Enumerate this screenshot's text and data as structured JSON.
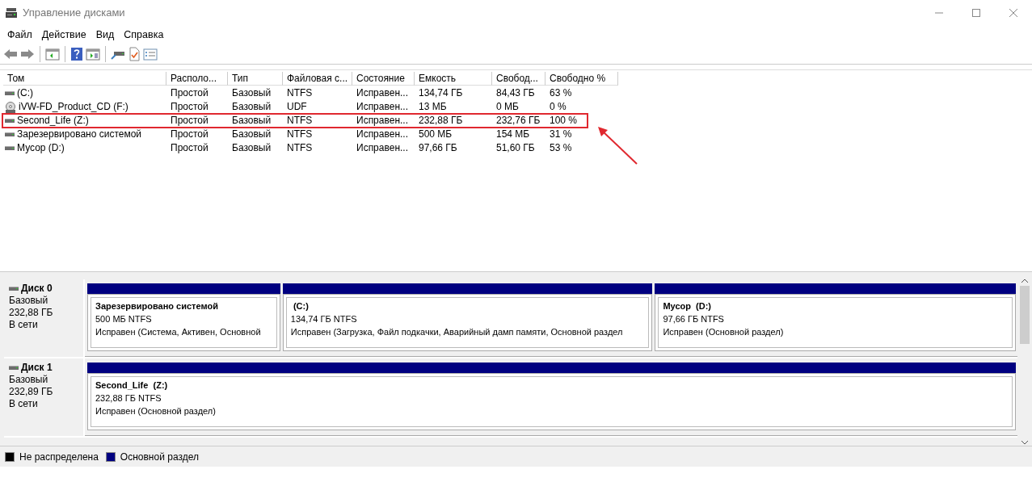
{
  "window": {
    "title": "Управление дисками"
  },
  "menu": [
    "Файл",
    "Действие",
    "Вид",
    "Справка"
  ],
  "table": {
    "columns": [
      "Том",
      "Располо...",
      "Тип",
      "Файловая с...",
      "Состояние",
      "Емкость",
      "Свобод...",
      "Свободно %"
    ],
    "rows": [
      {
        "kind": "disk",
        "highlighted": false,
        "cells": [
          "(C:)",
          "Простой",
          "Базовый",
          "NTFS",
          "Исправен...",
          "134,74 ГБ",
          "84,43 ГБ",
          "63 %"
        ]
      },
      {
        "kind": "cd",
        "highlighted": false,
        "cells": [
          "iVW-FD_Product_CD (F:)",
          "Простой",
          "Базовый",
          "UDF",
          "Исправен...",
          "13 МБ",
          "0 МБ",
          "0 %"
        ]
      },
      {
        "kind": "disk",
        "highlighted": true,
        "cells": [
          "Second_Life (Z:)",
          "Простой",
          "Базовый",
          "NTFS",
          "Исправен...",
          "232,88 ГБ",
          "232,76 ГБ",
          "100 %"
        ]
      },
      {
        "kind": "disk",
        "highlighted": false,
        "cells": [
          "Зарезервировано системой",
          "Простой",
          "Базовый",
          "NTFS",
          "Исправен...",
          "500 МБ",
          "154 МБ",
          "31 %"
        ]
      },
      {
        "kind": "disk",
        "highlighted": false,
        "cells": [
          "Мусор (D:)",
          "Простой",
          "Базовый",
          "NTFS",
          "Исправен...",
          "97,66 ГБ",
          "51,60 ГБ",
          "53 %"
        ]
      }
    ]
  },
  "disks": [
    {
      "name": "Диск 0",
      "type": "Базовый",
      "size": "232,88 ГБ",
      "status": "В сети",
      "partitions": [
        {
          "name": "Зарезервировано системой",
          "size": "500 МБ NTFS",
          "status": "Исправен (Система, Активен, Основной",
          "color": "#000080"
        },
        {
          "name": " (C:)",
          "size": "134,74 ГБ NTFS",
          "status": "Исправен (Загрузка, Файл подкачки, Аварийный дамп памяти, Основной раздел",
          "color": "#000080"
        },
        {
          "name": "Мусор  (D:)",
          "size": "97,66 ГБ NTFS",
          "status": "Исправен (Основной раздел)",
          "color": "#000080"
        }
      ]
    },
    {
      "name": "Диск 1",
      "type": "Базовый",
      "size": "232,89 ГБ",
      "status": "В сети",
      "partitions": [
        {
          "name": "Second_Life  (Z:)",
          "size": "232,88 ГБ NTFS",
          "status": "Исправен (Основной раздел)",
          "color": "#000080"
        }
      ]
    }
  ],
  "legend": [
    {
      "label": "Не распределена",
      "color": "#000000"
    },
    {
      "label": "Основной раздел",
      "color": "#000080"
    }
  ]
}
